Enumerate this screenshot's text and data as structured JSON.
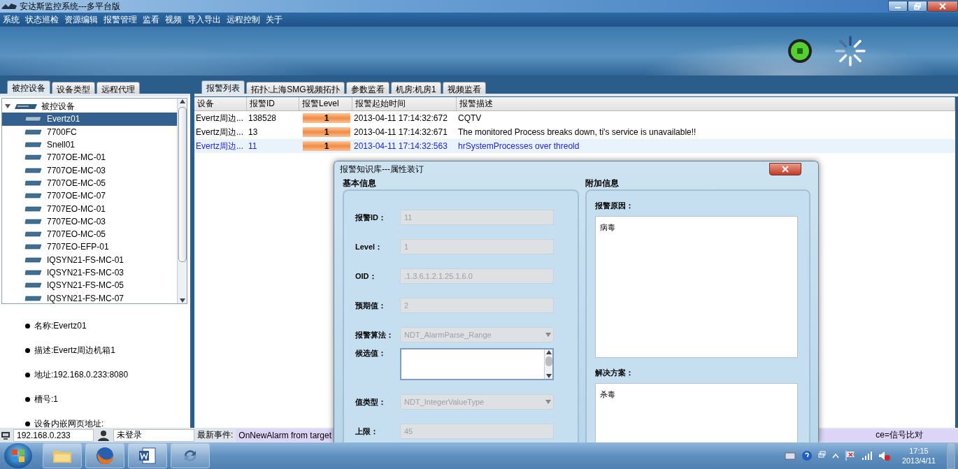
{
  "window": {
    "title": "安达斯监控系统---多平台版"
  },
  "menu": [
    "系统",
    "状态巡检",
    "资源编辑",
    "报警管理",
    "监看",
    "视频",
    "导入导出",
    "远程控制",
    "关于"
  ],
  "left_tabs": [
    {
      "label": "被控设备",
      "selected": true
    },
    {
      "label": "设备类型",
      "selected": false
    },
    {
      "label": "远程代理",
      "selected": false
    }
  ],
  "tree": {
    "label": "被控设备",
    "expanded": true,
    "children": [
      {
        "label": "Evertz01",
        "selected": true
      },
      {
        "label": "7700FC",
        "selected": false
      },
      {
        "label": "Snell01",
        "selected": false
      },
      {
        "label": "7707OE-MC-01",
        "selected": false
      },
      {
        "label": "7707OE-MC-03",
        "selected": false
      },
      {
        "label": "7707OE-MC-05",
        "selected": false
      },
      {
        "label": "7707OE-MC-07",
        "selected": false
      },
      {
        "label": "7707EO-MC-01",
        "selected": false
      },
      {
        "label": "7707EO-MC-03",
        "selected": false
      },
      {
        "label": "7707EO-MC-05",
        "selected": false
      },
      {
        "label": "7707EO-EFP-01",
        "selected": false
      },
      {
        "label": "IQSYN21-FS-MC-01",
        "selected": false
      },
      {
        "label": "IQSYN21-FS-MC-03",
        "selected": false
      },
      {
        "label": "IQSYN21-FS-MC-05",
        "selected": false
      },
      {
        "label": "IQSYN21-FS-MC-07",
        "selected": false
      }
    ]
  },
  "details": [
    "名称:Evertz01",
    "描述:Evertz周边机箱1",
    "地址:192.168.0.233:8080",
    "槽号:1",
    "设备内嵌网页地址:"
  ],
  "right_tabs": [
    {
      "label": "报警列表",
      "selected": true
    },
    {
      "label": "拓扑:上海SMG视频拓扑",
      "selected": false
    },
    {
      "label": "参数监看",
      "selected": false
    },
    {
      "label": "机房:机房1",
      "selected": false
    },
    {
      "label": "视频监看",
      "selected": false
    }
  ],
  "table": {
    "columns": [
      "设备",
      "报警ID",
      "报警Level",
      "报警起始时间",
      "报警描述"
    ],
    "rows": [
      {
        "device": "Evertz周边...",
        "id": "138528",
        "level": "1",
        "time": "2013-04-11 17:14:32:672",
        "description": "CQTV",
        "selected": false
      },
      {
        "device": "Evertz周边...",
        "id": "13",
        "level": "1",
        "time": "2013-04-11 17:14:32:671",
        "description": "The monitored Process breaks down, ti's service is unavailable!!",
        "selected": false
      },
      {
        "device": "Evertz周边...",
        "id": "11",
        "level": "1",
        "time": "2013-04-11 17:14:32:563",
        "description": "hrSystemProcesses over threold",
        "selected": true
      }
    ]
  },
  "dialog": {
    "title": "报警知识库---属性装订",
    "basic_title": "基本信息",
    "extra_title": "附加信息",
    "fields": [
      {
        "kind": "text",
        "label": "报警ID：",
        "value": "11",
        "disabled": true
      },
      {
        "kind": "text",
        "label": "Level：",
        "value": "1",
        "disabled": true
      },
      {
        "kind": "text",
        "label": "OID：",
        "value": ".1.3.6.1.2.1.25.1.6.0",
        "disabled": true
      },
      {
        "kind": "text",
        "label": "预期值：",
        "value": "2",
        "disabled": true
      },
      {
        "kind": "select",
        "label": "报警算法：",
        "value": "NDT_AlarmParse_Range",
        "disabled": true
      },
      {
        "kind": "list",
        "label": "候选值：",
        "disabled": false
      },
      {
        "kind": "select",
        "label": "值类型：",
        "value": "NDT_IntegerValueType",
        "disabled": true
      },
      {
        "kind": "text",
        "label": "上限：",
        "value": "45",
        "disabled": true
      }
    ],
    "cause_label": "报警原因：",
    "cause": "病毒",
    "solution_label": "解决方案：",
    "solution": "杀毒"
  },
  "status_bar": {
    "address": "192.168.0.233",
    "user": "未登录",
    "event_label": "最新事件:",
    "event_start": "OnNewAlarm from target",
    "event_end": "ce=信号比对"
  },
  "taskbar": {
    "time": "17:15",
    "date": "2013/4/11"
  }
}
